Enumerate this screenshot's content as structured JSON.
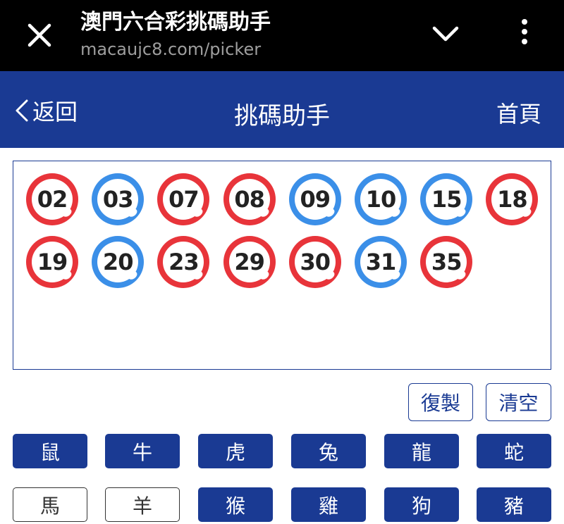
{
  "browser": {
    "title": "澳門六合彩挑碼助手",
    "url": "macaujc8.com/picker"
  },
  "header": {
    "back_label": "返回",
    "title": "挑碼助手",
    "home_label": "首頁"
  },
  "colors": {
    "brand_blue": "#1a3a93",
    "ball_red": "#e8343a",
    "ball_blue": "#3b8fe8"
  },
  "balls": [
    {
      "num": "02",
      "color": "red"
    },
    {
      "num": "03",
      "color": "blue"
    },
    {
      "num": "07",
      "color": "red"
    },
    {
      "num": "08",
      "color": "red"
    },
    {
      "num": "09",
      "color": "blue"
    },
    {
      "num": "10",
      "color": "blue"
    },
    {
      "num": "15",
      "color": "blue"
    },
    {
      "num": "18",
      "color": "red"
    },
    {
      "num": "19",
      "color": "red"
    },
    {
      "num": "20",
      "color": "blue"
    },
    {
      "num": "23",
      "color": "red"
    },
    {
      "num": "29",
      "color": "red"
    },
    {
      "num": "30",
      "color": "red"
    },
    {
      "num": "31",
      "color": "blue"
    },
    {
      "num": "35",
      "color": "red"
    }
  ],
  "actions": {
    "copy_label": "復製",
    "clear_label": "清空"
  },
  "zodiac": [
    {
      "label": "鼠",
      "selected": true
    },
    {
      "label": "牛",
      "selected": true
    },
    {
      "label": "虎",
      "selected": true
    },
    {
      "label": "兔",
      "selected": true
    },
    {
      "label": "龍",
      "selected": true
    },
    {
      "label": "蛇",
      "selected": true
    },
    {
      "label": "馬",
      "selected": false
    },
    {
      "label": "羊",
      "selected": false
    },
    {
      "label": "猴",
      "selected": true
    },
    {
      "label": "雞",
      "selected": true
    },
    {
      "label": "狗",
      "selected": true
    },
    {
      "label": "豬",
      "selected": true
    }
  ]
}
